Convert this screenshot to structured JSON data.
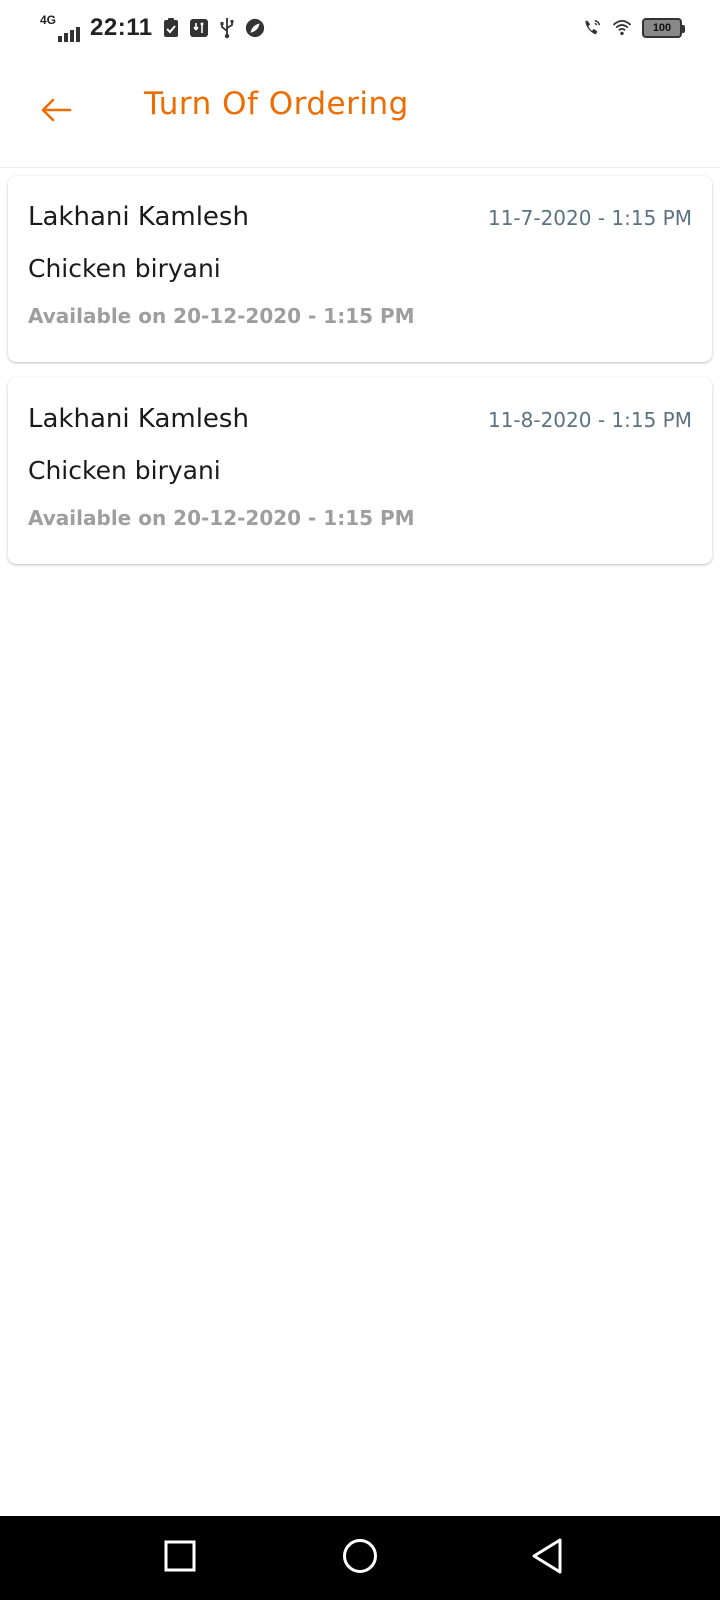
{
  "status_bar": {
    "network_type": "4G",
    "time": "22:11",
    "battery_level": "100"
  },
  "header": {
    "title": "Turn Of Ordering"
  },
  "orders": [
    {
      "name": "Lakhani Kamlesh",
      "date": "11-7-2020 - 1:15 PM",
      "item": "Chicken biryani",
      "available": "Available on 20-12-2020 - 1:15 PM"
    },
    {
      "name": "Lakhani Kamlesh",
      "date": "11-8-2020 - 1:15 PM",
      "item": "Chicken biryani",
      "available": "Available on 20-12-2020 - 1:15 PM"
    }
  ],
  "colors": {
    "accent": "#ef6c00",
    "date_text": "#5b7282",
    "muted_text": "#9e9e9e"
  },
  "icons": {
    "back": "arrow-left-icon",
    "nav_recent": "square-icon",
    "nav_home": "circle-icon",
    "nav_back": "triangle-back-icon"
  }
}
